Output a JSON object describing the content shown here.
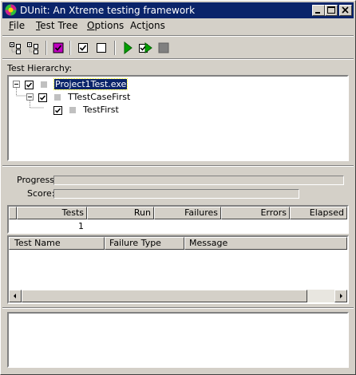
{
  "window": {
    "title": "DUnit: An Xtreme testing framework"
  },
  "titlebar_buttons": [
    "minimize",
    "maximize",
    "close"
  ],
  "menu": [
    {
      "label": "File",
      "mnemonic": "F"
    },
    {
      "label": "Test Tree",
      "mnemonic": "T"
    },
    {
      "label": "Options",
      "mnemonic": "O"
    },
    {
      "label": "Actions",
      "mnemonic": "i"
    }
  ],
  "toolbar": {
    "icons": [
      "expand-tree-icon",
      "collapse-tree-icon",
      "select-failed-icon",
      "check-all-icon",
      "uncheck-all-icon",
      "run-icon",
      "run-selected-icon",
      "stop-icon"
    ]
  },
  "hierarchy": {
    "label": "Test Hierarchy:",
    "nodes": [
      {
        "label": "Project1Test.exe",
        "checked": true,
        "selected": true,
        "level": 0
      },
      {
        "label": "TTestCaseFirst",
        "checked": true,
        "selected": false,
        "level": 1
      },
      {
        "label": "TestFirst",
        "checked": true,
        "selected": false,
        "level": 2
      }
    ]
  },
  "progress": {
    "label": "Progress:",
    "value": 0
  },
  "score": {
    "label": "Score:",
    "value": 0
  },
  "stats": {
    "columns": [
      "Tests",
      "Run",
      "Failures",
      "Errors",
      "Elapsed"
    ],
    "values": [
      "1",
      "",
      "",
      "",
      ""
    ]
  },
  "failures": {
    "columns": [
      "Test Name",
      "Failure Type",
      "Message"
    ]
  },
  "colors": {
    "titlebar": "#0a246a",
    "selection": "#0a246a",
    "face": "#d4d0c8"
  }
}
